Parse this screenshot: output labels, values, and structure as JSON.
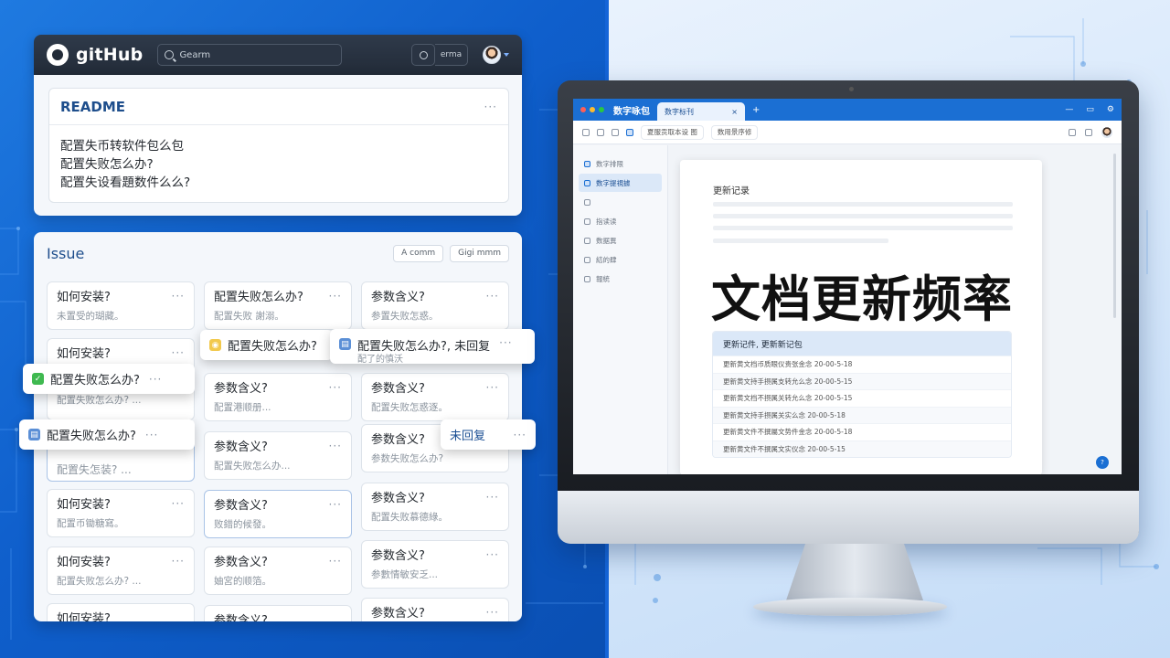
{
  "github": {
    "brand": "gitHub",
    "search_placeholder": "Gearm",
    "chip_label": "erma",
    "readme": {
      "title": "README",
      "lines": [
        "配置失币转软件包么包",
        "配置失败怎么办?",
        "配置失设看題数件么么?"
      ]
    }
  },
  "issues": {
    "title": "Issue",
    "actions": [
      "A  comm",
      "Gigi mmm"
    ],
    "cards": [
      {
        "title": "如何安装?",
        "sub": "未置受的瑚藏。"
      },
      {
        "title": "配置失败怎么办?",
        "sub": "配置失败 謝溺。"
      },
      {
        "title": "参数含义?",
        "sub": "参置失败怎惑。"
      },
      {
        "title": "如何安装?",
        "sub": ""
      },
      {
        "title": "参数含义?",
        "sub": "配置失败怎惑逐。"
      },
      {
        "title": "",
        "sub": "配置失败怎么办? ..."
      },
      {
        "title": "参数含义?",
        "sub": "配置港顺册..."
      },
      {
        "title": "参数含义?",
        "sub": "参数失败怎么办?"
      },
      {
        "title": "",
        "sub": "配置失怎装? ..."
      },
      {
        "title": "参数含义?",
        "sub": "配置失败怎么办..."
      },
      {
        "title": "如何安装?",
        "sub": "配置币锄糖寫。"
      },
      {
        "title": "参数含义?",
        "sub": "败錯的候發。"
      },
      {
        "title": "参数含义?",
        "sub": "配置失败慕德綠。"
      },
      {
        "title": "如何安装?",
        "sub": "配置失败怎么办? ..."
      },
      {
        "title": "参数含义?",
        "sub": "妯宮的顺箔。"
      },
      {
        "title": "参数含义?",
        "sub": "参數情敏安乏..."
      },
      {
        "title": "如何安装?",
        "sub": ""
      },
      {
        "title": "参数含义?",
        "sub": ""
      },
      {
        "title": "参数含义?",
        "sub": ""
      }
    ],
    "floats": {
      "f1": "配置失败怎么办?",
      "f2": "配置失败怎么办?",
      "f3": "配置失败怎么办?",
      "f4": "配置失败怎么办?, 未回复",
      "f4_sub": "配了的慎沃",
      "f5": "未回复"
    }
  },
  "desktop": {
    "app_title": "数字咏包",
    "tab_label": "数字标刊",
    "toolbar_field1": "夏服贡取本设 图",
    "toolbar_field2": "数用景序修",
    "sidebar": [
      "数字排限",
      "数字提視據",
      "",
      "指读读",
      "数据異",
      "結的肆",
      "報統"
    ],
    "doc": {
      "kicker": "更新记录",
      "headline": "文档更新频率",
      "table_header": "更新记件, 更新新记包",
      "rows": [
        "更新黄文档币质眼仪贵张金念  20-00-5-18",
        "更新黄文持手摂属支转允么念  20-00-5-15",
        "更新黄文档不摂属关转允么念  20-00-5-15",
        "更新黄文持手摂属关实么念  20-00-5-18",
        "更新黄文件不撰屬文势件金念  20-00-5-18",
        "更新黄文件不撰属文实仪念  20-00-5-15"
      ]
    }
  },
  "colors": {
    "left_bg": "#0f5fcc",
    "right_bg": "#d7e8fb",
    "accent": "#1b6fd3",
    "heading_blue": "#1e4e8c"
  }
}
